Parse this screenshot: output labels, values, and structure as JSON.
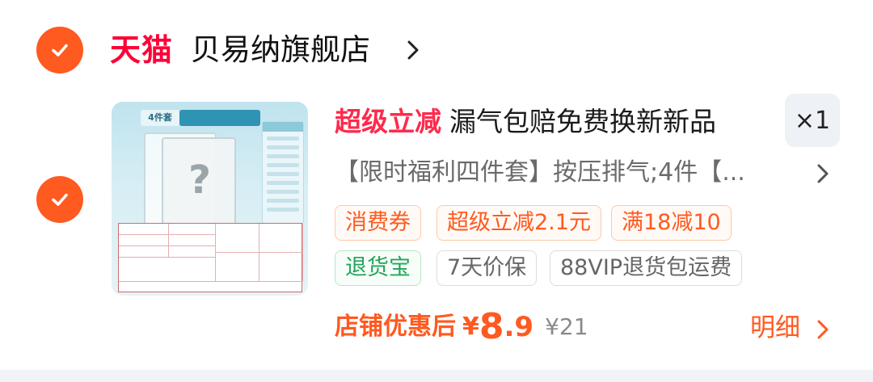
{
  "colors": {
    "accent": "#ff5a1f",
    "tmall_red": "#ff0036",
    "promo_red": "#ff2a4d",
    "green_tag": "#22a55a"
  },
  "store": {
    "platform_logo": "天猫",
    "name": "贝易纳旗舰店",
    "selected": true,
    "chevron_icon": "chevron-right-icon"
  },
  "item": {
    "selected": true,
    "thumbnail": {
      "tag_text": "4件套"
    },
    "promo_title": "超级立减",
    "title": "漏气包赔免费换新新品",
    "quantity": "×1",
    "sku": "【限时福利四件套】按压排气;4件【...",
    "tags": [
      {
        "label": "消费券",
        "style": "orange"
      },
      {
        "label": "超级立减2.1元",
        "style": "orange"
      },
      {
        "label": "满18减10",
        "style": "orange"
      },
      {
        "label": "退货宝",
        "style": "green"
      },
      {
        "label": "7天价保",
        "style": "gray"
      },
      {
        "label": "88VIP退货包运费",
        "style": "gray"
      }
    ],
    "price_label": "店铺优惠后",
    "currency": "¥",
    "price_int": "8",
    "price_dec": ".9",
    "original_price": "¥21",
    "detail_label": "明细"
  }
}
